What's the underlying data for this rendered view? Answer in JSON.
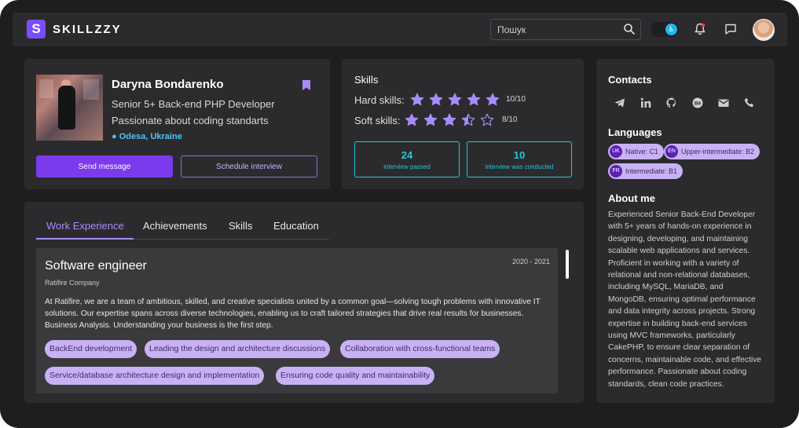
{
  "header": {
    "logo_mark": "S",
    "logo_text": "SKILLZZY",
    "search_placeholder": "Пошук",
    "toggle_icon": "accessibility-icon",
    "icons": [
      "search-icon",
      "bell-icon",
      "chat-icon"
    ],
    "notification_dot_color": "#ff3b30"
  },
  "profile": {
    "name": "Daryna Bondarenko",
    "role": "Senior 5+ Back-end PHP Developer",
    "passion": "Passionate about coding standarts",
    "location": "Odesa, Ukraine",
    "send_message": "Send message",
    "schedule_interview": "Schedule interview"
  },
  "skills": {
    "title": "Skills",
    "hard_label": "Hard skills:",
    "hard_score": "10/10",
    "hard_rating": 5,
    "soft_label": "Soft skills:",
    "soft_score": "8/10",
    "soft_rating": 3.5,
    "interviews_passed": "24",
    "interviews_passed_label": "interview passed",
    "interviews_conducted": "10",
    "interviews_conducted_label": "interview was conducted"
  },
  "contacts": {
    "title": "Contacts",
    "icons": [
      "telegram-icon",
      "linkedin-icon",
      "github-icon",
      "behance-icon",
      "email-icon",
      "phone-icon"
    ]
  },
  "languages": {
    "title": "Languages",
    "items": [
      {
        "code": "UK",
        "label": "Native: C1"
      },
      {
        "code": "EN",
        "label": "Upper-intermediate: B2"
      },
      {
        "code": "FR",
        "label": "Intermediate: B1"
      }
    ]
  },
  "about": {
    "title": "About me",
    "text": "Experienced Senior Back-End Developer with 5+ years of hands-on experience in designing, developing, and maintaining scalable web applications and services. Proficient in working with a variety of relational and non-relational databases, including MySQL, MariaDB, and MongoDB, ensuring optimal performance and data integrity across projects. Strong expertise in building back-end services using MVC frameworks, particularly CakePHP, to ensure clear separation of concerns, maintainable code, and effective performance. Passionate about coding standards, clean code practices."
  },
  "tabs": [
    "Work Experience",
    "Achievements",
    "Skills",
    "Education"
  ],
  "experience": {
    "title": "Software engineer",
    "date": "2020 - 2021",
    "company": "Ratifire Company",
    "description": "At Ratifire, we are a team of ambitious, skilled, and creative specialists united by a common goal—solving tough problems with innovative IT solutions. Our expertise spans across diverse technologies, enabling us to craft tailored strategies that drive real results for businesses. Business Analysis. Understanding your business is the first step.",
    "tags": [
      "BackEnd development",
      "Leading the design and architecture discussions",
      "Collaboration with cross-functional teams",
      "Service/database architecture design and implementation",
      "Ensuring code quality and maintainability"
    ]
  },
  "colors": {
    "accent": "#7c3aed",
    "tag_bg": "#c9b2f3",
    "cyan": "#26c6da",
    "star": "#a78bfa"
  }
}
